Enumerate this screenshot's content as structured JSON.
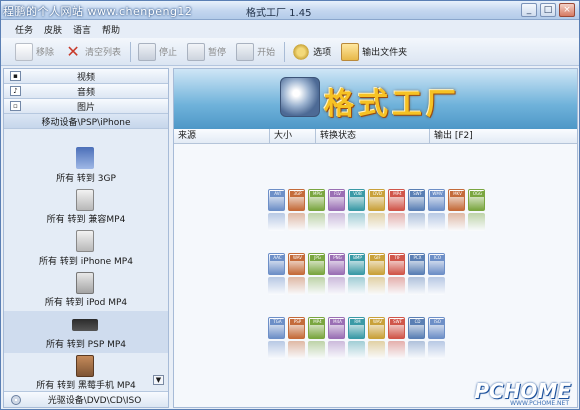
{
  "window": {
    "watermark": "程鹏的个人网站  www.chenpeng12",
    "title": "格式工厂 1.45",
    "minimize_glyph": "_",
    "maximize_glyph": "□",
    "close_glyph": "×"
  },
  "menu": [
    "任务",
    "皮肤",
    "语言",
    "帮助"
  ],
  "toolbar": {
    "remove": "移除",
    "clear": "清空列表",
    "stop": "停止",
    "pause": "暂停",
    "start": "开始",
    "options": "选项",
    "output_folder": "输出文件夹"
  },
  "sidebar": {
    "categories": [
      {
        "label": "视频",
        "icon": "video-icon"
      },
      {
        "label": "音频",
        "icon": "audio-icon"
      },
      {
        "label": "图片",
        "icon": "image-icon"
      },
      {
        "label": "移动设备\\PSP\\iPhone",
        "icon": "mobile-icon"
      }
    ],
    "items": [
      {
        "label": "所有 转到 3GP",
        "icon": "3gp-icon"
      },
      {
        "label": "所有 转到 兼容MP4",
        "icon": "mp4-icon"
      },
      {
        "label": "所有 转到 iPhone MP4",
        "icon": "iphone-mp4-icon"
      },
      {
        "label": "所有 转到 iPod MP4",
        "icon": "ipod-icon"
      },
      {
        "label": "所有 转到 PSP MP4",
        "icon": "psp-icon"
      },
      {
        "label": "所有 转到 黑莓手机 MP4",
        "icon": "blackberry-icon"
      }
    ],
    "scroll_glyph": "▼",
    "disc": "光驱设备\\DVD\\CD\\ISO"
  },
  "banner": {
    "title": "格式工厂"
  },
  "table": {
    "columns": [
      "来源",
      "大小",
      "转换状态",
      "输出 [F2]"
    ]
  },
  "formats": {
    "video": [
      "AVI",
      "3GP",
      "MPG",
      "FLV",
      "VOB",
      "DVD",
      "MP4",
      "SWF",
      "WMV",
      "MKV",
      "OGG"
    ],
    "audio_image": [
      "AAC",
      "WAV",
      "JPG",
      "PNG",
      "BMP",
      "GIF",
      "TIF",
      "PCX",
      "ICO"
    ],
    "more": [
      "TGA",
      "PSP",
      "MP4",
      "M4A",
      "RM",
      "WAV",
      "SWF",
      "CD",
      "ISO"
    ]
  },
  "colors": {
    "accent": "#5a7fb4",
    "banner_title": "#f6c224",
    "selection": "#cfdcee"
  },
  "brand": {
    "text": "PCHOME",
    "url": "WWW.PCHOME.NET"
  }
}
